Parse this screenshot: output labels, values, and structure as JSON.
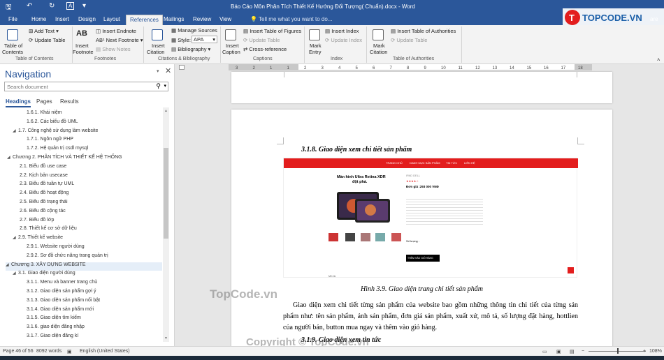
{
  "window": {
    "title": "Báo Cáo Môn Phân Tích Thiết Kế Hướng Đối Tượng( Chuẩn).docx - Word",
    "tabs": [
      "File",
      "Home",
      "Insert",
      "Design",
      "Layout",
      "References",
      "Mailings",
      "Review",
      "View"
    ],
    "active_tab": "References",
    "tell_me": "Tell me what you want to do...",
    "share": "are"
  },
  "ribbon": {
    "toc": {
      "table_of_contents": "Table of",
      "table_of_contents2": "Contents",
      "add_text": "Add Text",
      "update_table": "Update Table",
      "label": "Table of Contents"
    },
    "footnotes": {
      "insert_footnote": "Insert",
      "insert_footnote2": "Footnote",
      "ab": "AB",
      "insert_endnote": "Insert Endnote",
      "next_footnote": "Next Footnote",
      "show_notes": "Show Notes",
      "label": "Footnotes"
    },
    "citations": {
      "insert_citation": "Insert",
      "insert_citation2": "Citation",
      "manage_sources": "Manage Sources",
      "style_label": "Style:",
      "style_value": "APA",
      "bibliography": "Bibliography",
      "label": "Citations & Bibliography"
    },
    "captions": {
      "insert_caption": "Insert",
      "insert_caption2": "Caption",
      "insert_tof": "Insert Table of Figures",
      "update_table": "Update Table",
      "cross_reference": "Cross-reference",
      "label": "Captions"
    },
    "index": {
      "mark_entry": "Mark",
      "mark_entry2": "Entry",
      "insert_index": "Insert Index",
      "update_index": "Update Index",
      "label": "Index"
    },
    "authorities": {
      "mark_citation": "Mark",
      "mark_citation2": "Citation",
      "insert_toa": "Insert Table of Authorities",
      "update_table": "Update Table",
      "label": "Table of Authorities"
    }
  },
  "nav": {
    "title": "Navigation",
    "search_placeholder": "Search document",
    "tabs": [
      "Headings",
      "Pages",
      "Results"
    ],
    "items": [
      {
        "text": "1.6.1. Khái niệm",
        "level": 3,
        "arrow": ""
      },
      {
        "text": "1.6.2. Các biểu đồ UML",
        "level": 3,
        "arrow": ""
      },
      {
        "text": "1.7. Công nghệ sử dụng làm website",
        "level": 2,
        "arrow": "◢"
      },
      {
        "text": "1.7.1. Ngôn ngữ PHP",
        "level": 3,
        "arrow": ""
      },
      {
        "text": "1.7.2. Hệ quản trị csdl mysql",
        "level": 3,
        "arrow": ""
      },
      {
        "text": "Chương 2. PHÂN TÍCH VÀ THIẾT KẾ HỆ THỐNG",
        "level": 1,
        "arrow": "◢"
      },
      {
        "text": "2.1. Biểu đồ use case",
        "level": 2,
        "arrow": ""
      },
      {
        "text": "2.2. Kịch bản usecase",
        "level": 2,
        "arrow": ""
      },
      {
        "text": "2.3. Biểu đồ tuần tự UML",
        "level": 2,
        "arrow": ""
      },
      {
        "text": "2.4. Biểu đồ hoạt động",
        "level": 2,
        "arrow": ""
      },
      {
        "text": "2.5. Biểu đồ trạng thái",
        "level": 2,
        "arrow": ""
      },
      {
        "text": "2.6. Biểu đồ cộng tác",
        "level": 2,
        "arrow": ""
      },
      {
        "text": "2.7. Biểu đồ lớp",
        "level": 2,
        "arrow": ""
      },
      {
        "text": "2.8. Thiết kế cơ sở dữ liệu",
        "level": 2,
        "arrow": ""
      },
      {
        "text": "2.9. Thiết kế website",
        "level": 2,
        "arrow": "◢"
      },
      {
        "text": "2.9.1. Website người dùng",
        "level": 3,
        "arrow": ""
      },
      {
        "text": "2.9.2. Sơ đồ chức năng trang quản trị",
        "level": 3,
        "arrow": ""
      },
      {
        "text": "Chương 3. XÂY DỰNG WEBSITE",
        "level": 1,
        "arrow": "◢",
        "selected": true
      },
      {
        "text": "3.1. Giao diện người dùng",
        "level": 2,
        "arrow": "◢"
      },
      {
        "text": "3.1.1. Menu và banner trang chủ",
        "level": 3,
        "arrow": ""
      },
      {
        "text": "3.1.2. Giao diện sản phẩm gợi ý",
        "level": 3,
        "arrow": ""
      },
      {
        "text": "3.1.3. Giao diện sản phẩm nổi bật",
        "level": 3,
        "arrow": ""
      },
      {
        "text": "3.1.4. Giao diện sản phẩm mới",
        "level": 3,
        "arrow": ""
      },
      {
        "text": "3.1.5. Giao diện tìm kiếm",
        "level": 3,
        "arrow": ""
      },
      {
        "text": "3.1.6. giao diện đăng nhập",
        "level": 3,
        "arrow": ""
      },
      {
        "text": "3.1.7. Giao diện đăng kí",
        "level": 3,
        "arrow": ""
      }
    ]
  },
  "ruler_ticks": [
    "3",
    "2",
    "1",
    "1",
    "2",
    "3",
    "4",
    "5",
    "6",
    "7",
    "8",
    "9",
    "10",
    "11",
    "12",
    "13",
    "14",
    "15",
    "16",
    "17",
    "18"
  ],
  "document": {
    "heading": "3.1.8. Giao diện xem chi tiết sản phẩm",
    "screenshot": {
      "menu": [
        "TRANG CHỦ",
        "DANH MỤC SẢN PHẨM",
        "TIN TỨC",
        "LIÊN HỆ"
      ],
      "banner_text": "Màn hình Ultra Retina XDR",
      "banner_text2": "đột phá.",
      "product_name": "IPAD DELL",
      "price": "Đơn giá :293 000 VNĐ",
      "qty_label": "Số lượng :",
      "buy_button": "THÊM VÀO GIỎ HÀNG",
      "footer_text": "Mô tả"
    },
    "caption": "Hình 3.9. Giao diện trang chi tiết sản phẩm",
    "body": "Giao diện xem chi tiết từng sản phẩm của website bao gồm những thông tin chi tiết của từng sản phẩm như: tên sản phẩm, ảnh sản phẩm, đơn giá sản phẩm, xuất xứ, mô tả, số lượng đặt hàng, hottlien của người bán, button mua ngay và thêm vào giỏ hàng.",
    "next_heading": "3.1.9. Giao diện xem tin tức"
  },
  "status": {
    "page": "Page 46 of 56",
    "words": "8092 words",
    "language": "English (United States)",
    "zoom": "108%"
  },
  "watermarks": {
    "logo_text": "TOPCODE.VN",
    "mid": "TopCode.vn",
    "bottom": "Copyright © TopCode.vn"
  },
  "colors": {
    "word_blue": "#2b579a",
    "accent_red": "#e31d1d"
  }
}
